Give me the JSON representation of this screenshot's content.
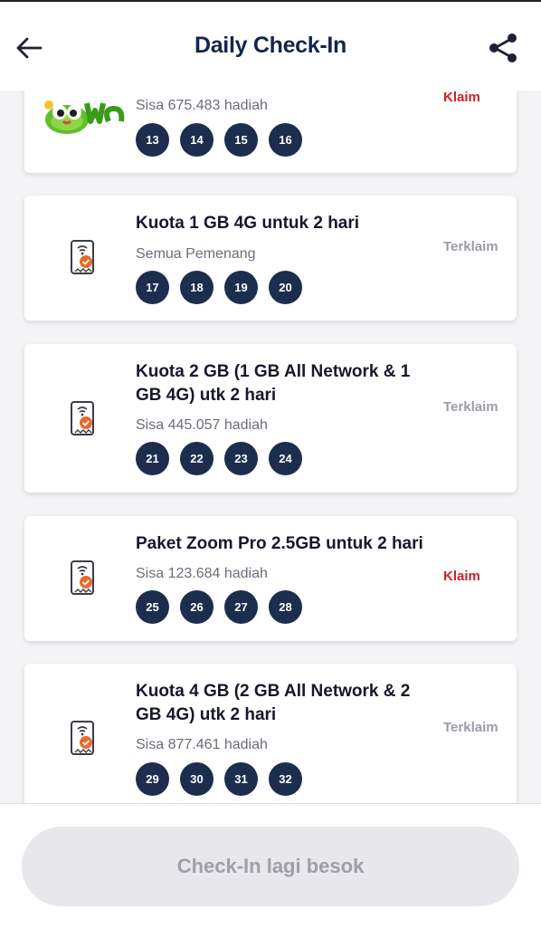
{
  "header": {
    "title": "Daily Check-In",
    "back_icon": "arrow-left-icon",
    "share_icon": "share-icon"
  },
  "rewards": [
    {
      "name": "",
      "stock": "Sisa 675.483 hadiah",
      "status": "Klaim",
      "days": [
        "13",
        "14",
        "15",
        "16"
      ]
    },
    {
      "name": "Kuota 1 GB 4G untuk 2 hari",
      "stock": "Semua Pemenang",
      "status": "Terklaim",
      "days": [
        "17",
        "18",
        "19",
        "20"
      ]
    },
    {
      "name": "Kuota 2 GB (1 GB All Network & 1 GB 4G) utk 2 hari",
      "stock": "Sisa 445.057 hadiah",
      "status": "Terklaim",
      "days": [
        "21",
        "22",
        "23",
        "24"
      ]
    },
    {
      "name": "Paket Zoom Pro 2.5GB untuk 2 hari",
      "stock": "Sisa 123.684 hadiah",
      "status": "Klaim",
      "days": [
        "25",
        "26",
        "27",
        "28"
      ]
    },
    {
      "name": "Kuota 4 GB (2 GB All Network & 2 GB 4G) utk 2 hari",
      "stock": "Sisa 877.461 hadiah",
      "status": "Terklaim",
      "days": [
        "29",
        "30",
        "31",
        "32"
      ]
    }
  ],
  "footer": {
    "cta_label": "Check-In lagi besok"
  },
  "colors": {
    "title": "#14254d",
    "day_badge": "#1c2d4e",
    "claim": "#d0202a",
    "claimed": "#9a9da6",
    "cta_bg": "#e7e7ec"
  }
}
